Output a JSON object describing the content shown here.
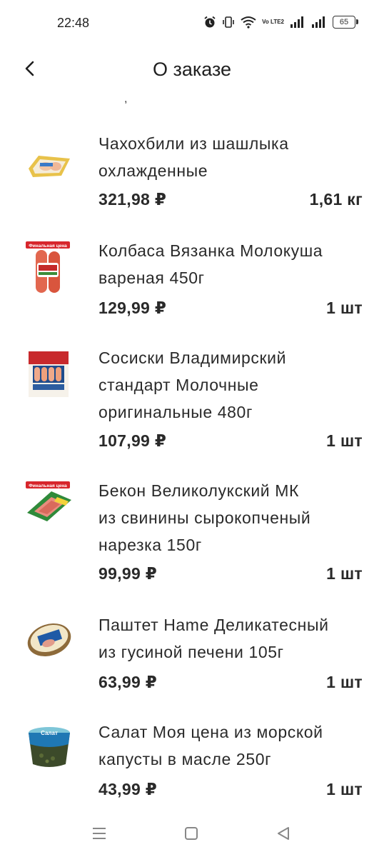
{
  "status_bar": {
    "time": "22:48",
    "battery": "65",
    "volte_label": "Vo LTE2",
    "icons": [
      "alarm-icon",
      "vibrate-icon",
      "wifi-icon",
      "volte-icon",
      "signal-icon",
      "signal-icon",
      "battery-icon"
    ]
  },
  "header": {
    "back_icon": "chevron-left-icon",
    "title": "О заказе"
  },
  "items": [
    {
      "name_line1": "Чахохбили из шашлыка",
      "name_line2": "охлажденные",
      "price": "321,98 ₽",
      "qty": "1,61 кг",
      "image": "chicken-tray-image"
    },
    {
      "name_line1": "Колбаса Вязанка Молокуша",
      "name_line2": "вареная 450г",
      "price": "129,99 ₽",
      "qty": "1 шт",
      "image": "sausage-pack-image",
      "image_badge": "Финальная цена"
    },
    {
      "name_line1": "Сосиски Владимирский",
      "name_line2": "стандарт Молочные",
      "name_line3": "оригинальные 480г",
      "price": "107,99 ₽",
      "qty": "1 шт",
      "image": "frankfurters-pack-image"
    },
    {
      "name_line1": "Бекон Великолукский МК",
      "name_line2": "из свинины сырокопченый",
      "name_line3": "нарезка 150г",
      "price": "99,99 ₽",
      "qty": "1 шт",
      "image": "bacon-pack-image",
      "image_badge": "Финальная цена"
    },
    {
      "name_line1": "Паштет Hame Деликатесный",
      "name_line2": "из гусиной печени 105г",
      "price": "63,99 ₽",
      "qty": "1 шт",
      "image": "pate-can-image"
    },
    {
      "name_line1": "Салат Моя цена из морской",
      "name_line2": "капусты в масле 250г",
      "price": "43,99 ₽",
      "qty": "1 шт",
      "image": "seaweed-salad-image",
      "image_label": "Салат"
    }
  ],
  "nav_bar": {
    "menu_icon": "menu-icon",
    "home_icon": "home-square-icon",
    "back_icon": "back-triangle-icon"
  },
  "colors": {
    "text": "#2a2a2a",
    "badge_red": "#d7262c",
    "accent_blue": "#1f5aa6",
    "accent_green": "#2f8a3a"
  }
}
